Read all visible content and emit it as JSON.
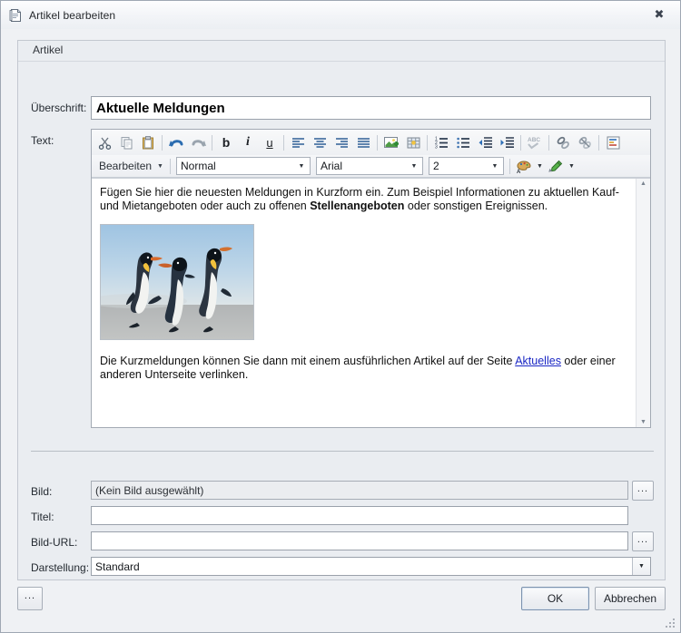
{
  "window": {
    "title": "Artikel bearbeiten",
    "icon": "document-icon",
    "close_label": "✖"
  },
  "group": {
    "label": "Artikel"
  },
  "fields": {
    "headline": {
      "label": "Überschrift:",
      "value": "Aktuelle Meldungen"
    },
    "text": {
      "label": "Text:"
    },
    "bild": {
      "label": "Bild:",
      "value": "(Kein Bild ausgewählt)",
      "browse_label": "..."
    },
    "titel": {
      "label": "Titel:",
      "value": ""
    },
    "bild_url": {
      "label": "Bild-URL:",
      "value": "",
      "browse_label": "..."
    },
    "darstellung": {
      "label": "Darstellung:",
      "value": "Standard",
      "arrow": "▼"
    }
  },
  "editor": {
    "toolbar_row1": [
      {
        "name": "cut-icon",
        "title": "Ausschneiden"
      },
      {
        "name": "copy-icon",
        "title": "Kopieren"
      },
      {
        "name": "paste-icon",
        "title": "Einfügen"
      },
      {
        "name": "undo-icon",
        "title": "Rückgängig"
      },
      {
        "name": "redo-icon",
        "title": "Wiederholen"
      },
      {
        "name": "bold-icon",
        "title": "Fett",
        "glyph": "b"
      },
      {
        "name": "italic-icon",
        "title": "Kursiv",
        "glyph": "i"
      },
      {
        "name": "underline-icon",
        "title": "Unterstrichen",
        "glyph": "u"
      },
      {
        "name": "align-left-icon",
        "title": "Linksbündig"
      },
      {
        "name": "align-center-icon",
        "title": "Zentriert"
      },
      {
        "name": "align-right-icon",
        "title": "Rechtsbündig"
      },
      {
        "name": "align-justify-icon",
        "title": "Blocksatz"
      },
      {
        "name": "insert-image-icon",
        "title": "Bild einfügen"
      },
      {
        "name": "insert-table-icon",
        "title": "Tabelle einfügen"
      },
      {
        "name": "ordered-list-icon",
        "title": "Nummerierte Liste"
      },
      {
        "name": "unordered-list-icon",
        "title": "Aufzählung"
      },
      {
        "name": "outdent-icon",
        "title": "Einzug verkleinern"
      },
      {
        "name": "indent-icon",
        "title": "Einzug vergrößern"
      },
      {
        "name": "spellcheck-icon",
        "title": "Rechtschreibprüfung"
      },
      {
        "name": "insert-link-icon",
        "title": "Link einfügen"
      },
      {
        "name": "remove-link-icon",
        "title": "Link entfernen"
      },
      {
        "name": "source-view-icon",
        "title": "Quelltext"
      }
    ],
    "toolbar_row2": {
      "menu_label": "Bearbeiten",
      "menu_caret": "▼",
      "style_value": "Normal",
      "font_value": "Arial",
      "size_value": "2",
      "text_color_icon": "text-color-icon",
      "highlight_icon": "highlight-pen-icon",
      "caret": "▼"
    },
    "content": {
      "paragraph1_part1": "Fügen Sie hier die neuesten Meldungen in Kurzform ein. Zum Beispiel Informationen zu aktuellen Kauf- und Mietangeboten oder auch zu offenen ",
      "paragraph1_bold": "Stellenangeboten",
      "paragraph1_part2": " oder sonstigen Ereignissen.",
      "image_alt": "penguins-photo",
      "paragraph2_part1": "Die Kurzmeldungen können Sie dann mit einem ausführlichen Artikel auf der Seite ",
      "paragraph2_link": "Aktuelles",
      "paragraph2_part2": " oder einer anderen Unterseite verlinken."
    },
    "scrollbar": {
      "up": "▲",
      "down": "▼"
    }
  },
  "footer": {
    "options_label": "...",
    "ok_label": "OK",
    "cancel_label": "Abbrechen"
  },
  "colors": {
    "window_bg": "#eff1f4",
    "group_bg": "#eaedf1",
    "border": "#9aa1ab",
    "link": "#1a27c4",
    "default_button_border": "#7d93ae"
  }
}
